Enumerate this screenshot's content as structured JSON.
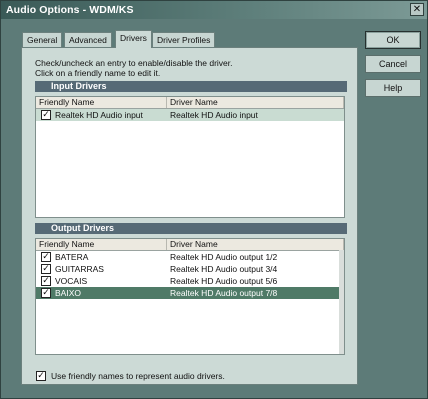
{
  "window": {
    "title": "Audio Options - WDM/KS",
    "close_glyph": "✕"
  },
  "tabs": [
    {
      "label": "General",
      "active": false
    },
    {
      "label": "Advanced",
      "active": false
    },
    {
      "label": "Drivers",
      "active": true
    },
    {
      "label": "Driver Profiles",
      "active": false
    }
  ],
  "instructions": {
    "line1": "Check/uncheck an entry to enable/disable the driver.",
    "line2": "Click on a friendly name to edit it."
  },
  "input_drivers": {
    "header": "Input Drivers",
    "columns": [
      "Friendly Name",
      "Driver Name"
    ],
    "rows": [
      {
        "checked": true,
        "name": "Realtek HD Audio input",
        "driver": "Realtek HD Audio input"
      }
    ]
  },
  "output_drivers": {
    "header": "Output Drivers",
    "columns": [
      "Friendly Name",
      "Driver Name"
    ],
    "rows": [
      {
        "checked": true,
        "name": "BATERA",
        "driver": "Realtek HD Audio output 1/2"
      },
      {
        "checked": true,
        "name": "GUITARRAS",
        "driver": "Realtek HD Audio output 3/4"
      },
      {
        "checked": true,
        "name": "VOCAIS",
        "driver": "Realtek HD Audio output 5/6"
      },
      {
        "checked": true,
        "name": "BAIXO",
        "driver": "Realtek HD Audio output 7/8",
        "selected": true
      }
    ]
  },
  "use_friendly": {
    "checked": true,
    "label": "Use friendly names to represent audio drivers."
  },
  "buttons": {
    "ok": "OK",
    "cancel": "Cancel",
    "help": "Help"
  },
  "check_glyph": "✓"
}
